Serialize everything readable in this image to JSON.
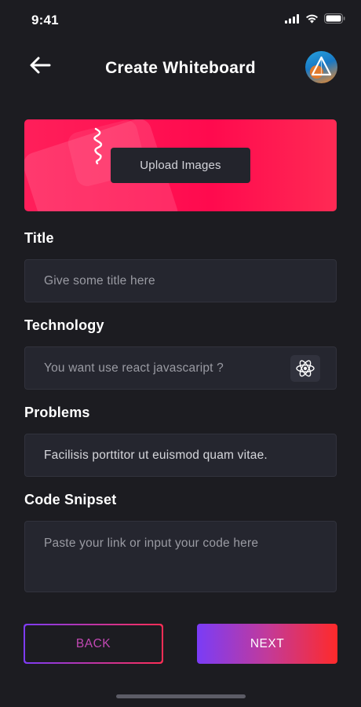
{
  "status_bar": {
    "time": "9:41"
  },
  "header": {
    "title": "Create Whiteboard"
  },
  "upload": {
    "button_label": "Upload Images"
  },
  "form": {
    "title": {
      "label": "Title",
      "placeholder": "Give some title here"
    },
    "technology": {
      "label": "Technology",
      "placeholder": "You want use react javascaript ?"
    },
    "problems": {
      "label": "Problems",
      "value": "Facilisis porttitor ut euismod quam vitae."
    },
    "code_snippet": {
      "label": "Code Snipset",
      "placeholder": "Paste your link or input your code here"
    }
  },
  "actions": {
    "back_label": "BACK",
    "next_label": "NEXT"
  },
  "icons": {
    "back": "arrow-left-icon",
    "avatar": "avatar",
    "react": "react-icon",
    "signal": "signal-icon",
    "wifi": "wifi-icon",
    "battery": "battery-icon"
  },
  "colors": {
    "background": "#1c1c21",
    "field": "#25262f",
    "banner": "#ff0a4e",
    "gradient_start": "#7d3cf5",
    "gradient_end": "#ff2d55"
  }
}
